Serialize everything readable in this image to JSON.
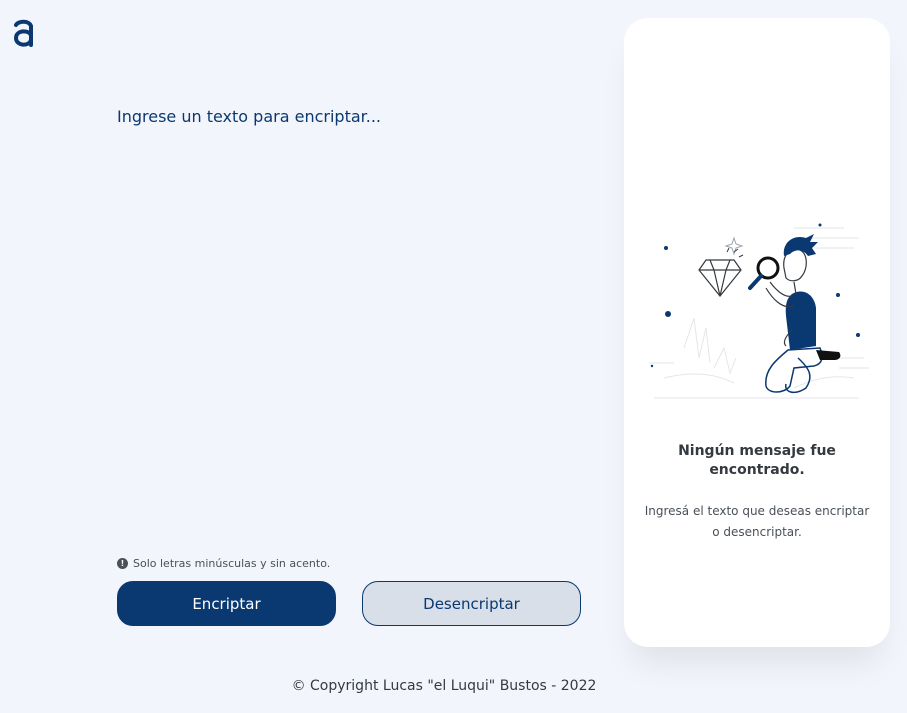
{
  "header": {
    "logo_icon": "alura-a-logo-icon"
  },
  "editor": {
    "placeholder": "Ingrese un texto para encriptar...",
    "value": ""
  },
  "hint": {
    "icon": "info-circle-icon",
    "text": "Solo letras minúsculas y sin acento."
  },
  "actions": {
    "encrypt_label": "Encriptar",
    "decrypt_label": "Desencriptar"
  },
  "result_panel": {
    "illustration": "person-with-magnifying-glass-illustration",
    "title": "Ningún mensaje fue encontrado.",
    "message": "Ingresá el texto que deseas encriptar o desencriptar."
  },
  "footer": {
    "copyright": "© Copyright Lucas \"el Luqui\" Bustos - 2022"
  },
  "colors": {
    "background": "#f3f5fc",
    "primary": "#0a3871",
    "secondary_button": "#d8dfe8",
    "panel": "#ffffff"
  }
}
